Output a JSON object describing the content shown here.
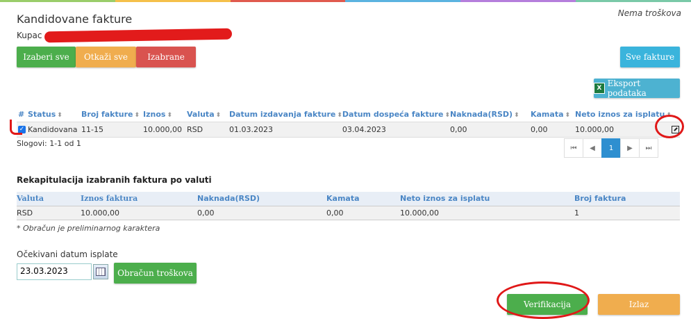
{
  "header": {
    "title": "Kandidovane fakture",
    "no_cost": "Nema troškova",
    "buyer_label": "Kupac"
  },
  "buttons": {
    "select_all": "Izaberi sve",
    "cancel_all": "Otkaži sve",
    "selected": "Izabrane",
    "all_invoices": "Sve fakture",
    "export": "Eksport podataka",
    "calc_costs": "Obračun troškova",
    "verify": "Verifikacija",
    "exit": "Izlaz"
  },
  "invoice_table": {
    "headers": [
      "#",
      "Status",
      "Broj fakture",
      "Iznos",
      "Valuta",
      "Datum izdavanja fakture",
      "Datum dospeća fakture",
      "Naknada(RSD)",
      "Kamata",
      "Neto iznos za isplatu"
    ],
    "rows": [
      {
        "checked": true,
        "status": "Kandidovana",
        "number": "11-15",
        "amount": "10.000,00",
        "currency": "RSD",
        "issue_date": "01.03.2023",
        "due_date": "03.04.2023",
        "fee": "0,00",
        "interest": "0,00",
        "net": "10.000,00"
      }
    ],
    "records": "Slogovi: 1-1 od 1"
  },
  "pager": {
    "current_page": "1"
  },
  "recap": {
    "title": "Rekapitulacija izabranih faktura po valuti",
    "headers": [
      "Valuta",
      "Iznos faktura",
      "Naknada(RSD)",
      "Kamata",
      "Neto iznos za isplatu",
      "Broj faktura"
    ],
    "rows": [
      {
        "currency": "RSD",
        "amount": "10.000,00",
        "fee": "0,00",
        "interest": "0,00",
        "net": "10.000,00",
        "count": "1"
      }
    ],
    "note": "* Obračun je preliminarnog karaktera"
  },
  "payment": {
    "label": "Očekivani datum isplate",
    "date_value": "23.03.2023"
  },
  "colors": {
    "green": "#4cae4c",
    "orange": "#f0ad4e",
    "red": "#d9534f",
    "blue": "#3ab4dc",
    "header_text": "#4a86c5",
    "annotation": "#e01818"
  }
}
